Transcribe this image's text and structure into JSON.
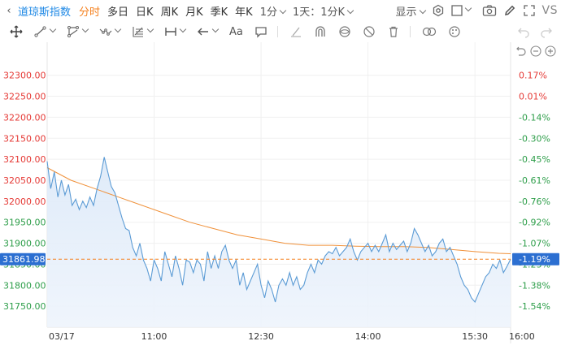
{
  "topbar": {
    "back_icon": "chevron-left-icon",
    "title": "道琼斯指数",
    "periods": [
      "分时",
      "多日",
      "日K",
      "周K",
      "月K",
      "季K",
      "年K"
    ],
    "active_period": "分时",
    "interval_select": "1分",
    "range_select": "1天：1分K",
    "display_select": "显示",
    "right_icons": [
      "settings-icon",
      "square-icon",
      "camera-icon",
      "pen-icon",
      "fullscreen-icon"
    ],
    "vs_label": "VS"
  },
  "tools": {
    "icons": [
      "crosshair-icon",
      "line-tool-icon",
      "polyline-tool-icon",
      "wave-tool-icon",
      "fib-tool-icon",
      "measure-tool-icon",
      "arrow-tool-icon",
      "text-tool-icon",
      "comment-icon",
      "eraser-icon",
      "magnet-icon",
      "eye-hide-icon",
      "visibility-off-icon",
      "trash-icon",
      "compare-icon",
      "theme-icon"
    ],
    "text_label": "Aa",
    "undo_icon": "undo-icon",
    "redo_icon": "redo-icon"
  },
  "zoom": {
    "icons": [
      "reset-icon",
      "zoom-out-icon",
      "zoom-in-icon"
    ]
  },
  "colors": {
    "accent": "#f5811f",
    "title": "#1e88e5",
    "up": "#e53935",
    "down": "#2e9e4a",
    "price_line": "#5b9bd5",
    "avg_line": "#f0913a",
    "current_badge": "#2c6fd1"
  },
  "chart_data": {
    "type": "area",
    "title": "",
    "xlabel": "",
    "ylabel": "",
    "ylim": [
      31700,
      32340
    ],
    "left_ticks": [
      "32300.00",
      "32250.00",
      "32200.00",
      "32150.00",
      "32100.00",
      "32050.00",
      "32000.00",
      "31950.00",
      "31900.00",
      "31850.00",
      "31800.00",
      "31750.00"
    ],
    "left_tick_values": [
      32300,
      32250,
      32200,
      32150,
      32100,
      32050,
      32000,
      31950,
      31900,
      31850,
      31800,
      31750
    ],
    "right_ticks": [
      "0.17%",
      "0.01%",
      "-0.14%",
      "-0.30%",
      "-0.45%",
      "-0.61%",
      "-0.76%",
      "-0.92%",
      "-1.07%",
      "-1.23%",
      "-1.38%",
      "-1.54%"
    ],
    "x_ticks": [
      {
        "label": "03/17",
        "t": 0
      },
      {
        "label": "11:00",
        "t": 90
      },
      {
        "label": "12:30",
        "t": 180
      },
      {
        "label": "14:00",
        "t": 270
      },
      {
        "label": "15:30",
        "t": 360
      },
      {
        "label": "16:00",
        "t": 390
      }
    ],
    "x_range": [
      0,
      390
    ],
    "current_price": "31861.98",
    "current_value": 31861.98,
    "current_pct": "-1.19%",
    "series": [
      {
        "kind": "price",
        "points": [
          [
            0,
            32095
          ],
          [
            3,
            32030
          ],
          [
            6,
            32070
          ],
          [
            9,
            32010
          ],
          [
            12,
            32050
          ],
          [
            15,
            32015
          ],
          [
            18,
            32040
          ],
          [
            21,
            31990
          ],
          [
            24,
            32005
          ],
          [
            27,
            31980
          ],
          [
            30,
            32000
          ],
          [
            33,
            31985
          ],
          [
            36,
            32010
          ],
          [
            39,
            31990
          ],
          [
            42,
            32030
          ],
          [
            45,
            32060
          ],
          [
            48,
            32105
          ],
          [
            51,
            32070
          ],
          [
            54,
            32035
          ],
          [
            57,
            32020
          ],
          [
            60,
            31990
          ],
          [
            63,
            31960
          ],
          [
            66,
            31935
          ],
          [
            69,
            31930
          ],
          [
            72,
            31890
          ],
          [
            75,
            31870
          ],
          [
            78,
            31900
          ],
          [
            81,
            31860
          ],
          [
            84,
            31840
          ],
          [
            87,
            31810
          ],
          [
            90,
            31860
          ],
          [
            93,
            31840
          ],
          [
            96,
            31810
          ],
          [
            99,
            31880
          ],
          [
            102,
            31850
          ],
          [
            105,
            31820
          ],
          [
            108,
            31870
          ],
          [
            111,
            31840
          ],
          [
            114,
            31800
          ],
          [
            117,
            31860
          ],
          [
            120,
            31855
          ],
          [
            123,
            31830
          ],
          [
            126,
            31860
          ],
          [
            129,
            31850
          ],
          [
            132,
            31810
          ],
          [
            135,
            31880
          ],
          [
            138,
            31840
          ],
          [
            141,
            31870
          ],
          [
            144,
            31840
          ],
          [
            147,
            31880
          ],
          [
            150,
            31895
          ],
          [
            153,
            31860
          ],
          [
            156,
            31840
          ],
          [
            159,
            31860
          ],
          [
            162,
            31800
          ],
          [
            165,
            31830
          ],
          [
            168,
            31790
          ],
          [
            171,
            31810
          ],
          [
            174,
            31830
          ],
          [
            177,
            31850
          ],
          [
            180,
            31800
          ],
          [
            183,
            31770
          ],
          [
            186,
            31810
          ],
          [
            189,
            31790
          ],
          [
            192,
            31760
          ],
          [
            195,
            31800
          ],
          [
            198,
            31815
          ],
          [
            201,
            31800
          ],
          [
            204,
            31830
          ],
          [
            207,
            31800
          ],
          [
            210,
            31820
          ],
          [
            213,
            31790
          ],
          [
            216,
            31800
          ],
          [
            219,
            31830
          ],
          [
            222,
            31850
          ],
          [
            225,
            31830
          ],
          [
            228,
            31860
          ],
          [
            231,
            31850
          ],
          [
            234,
            31870
          ],
          [
            237,
            31880
          ],
          [
            240,
            31875
          ],
          [
            243,
            31890
          ],
          [
            246,
            31870
          ],
          [
            249,
            31880
          ],
          [
            252,
            31890
          ],
          [
            255,
            31910
          ],
          [
            258,
            31880
          ],
          [
            261,
            31860
          ],
          [
            264,
            31880
          ],
          [
            267,
            31890
          ],
          [
            270,
            31900
          ],
          [
            273,
            31880
          ],
          [
            276,
            31895
          ],
          [
            279,
            31880
          ],
          [
            282,
            31900
          ],
          [
            285,
            31920
          ],
          [
            288,
            31880
          ],
          [
            291,
            31900
          ],
          [
            294,
            31885
          ],
          [
            297,
            31895
          ],
          [
            300,
            31905
          ],
          [
            303,
            31880
          ],
          [
            306,
            31900
          ],
          [
            309,
            31935
          ],
          [
            312,
            31920
          ],
          [
            315,
            31900
          ],
          [
            318,
            31880
          ],
          [
            321,
            31895
          ],
          [
            324,
            31870
          ],
          [
            327,
            31880
          ],
          [
            330,
            31900
          ],
          [
            333,
            31910
          ],
          [
            336,
            31880
          ],
          [
            339,
            31890
          ],
          [
            342,
            31870
          ],
          [
            345,
            31850
          ],
          [
            348,
            31820
          ],
          [
            351,
            31800
          ],
          [
            354,
            31790
          ],
          [
            357,
            31770
          ],
          [
            360,
            31760
          ],
          [
            363,
            31780
          ],
          [
            366,
            31800
          ],
          [
            369,
            31820
          ],
          [
            372,
            31830
          ],
          [
            375,
            31850
          ],
          [
            378,
            31840
          ],
          [
            381,
            31860
          ],
          [
            384,
            31830
          ],
          [
            387,
            31845
          ],
          [
            390,
            31862
          ]
        ]
      },
      {
        "kind": "average",
        "points": [
          [
            0,
            32080
          ],
          [
            20,
            32050
          ],
          [
            40,
            32030
          ],
          [
            60,
            32010
          ],
          [
            80,
            31990
          ],
          [
            100,
            31970
          ],
          [
            120,
            31950
          ],
          [
            140,
            31935
          ],
          [
            160,
            31920
          ],
          [
            180,
            31910
          ],
          [
            200,
            31900
          ],
          [
            220,
            31895
          ],
          [
            240,
            31895
          ],
          [
            260,
            31893
          ],
          [
            280,
            31892
          ],
          [
            300,
            31892
          ],
          [
            320,
            31890
          ],
          [
            340,
            31885
          ],
          [
            360,
            31880
          ],
          [
            380,
            31876
          ],
          [
            390,
            31875
          ]
        ]
      }
    ]
  }
}
